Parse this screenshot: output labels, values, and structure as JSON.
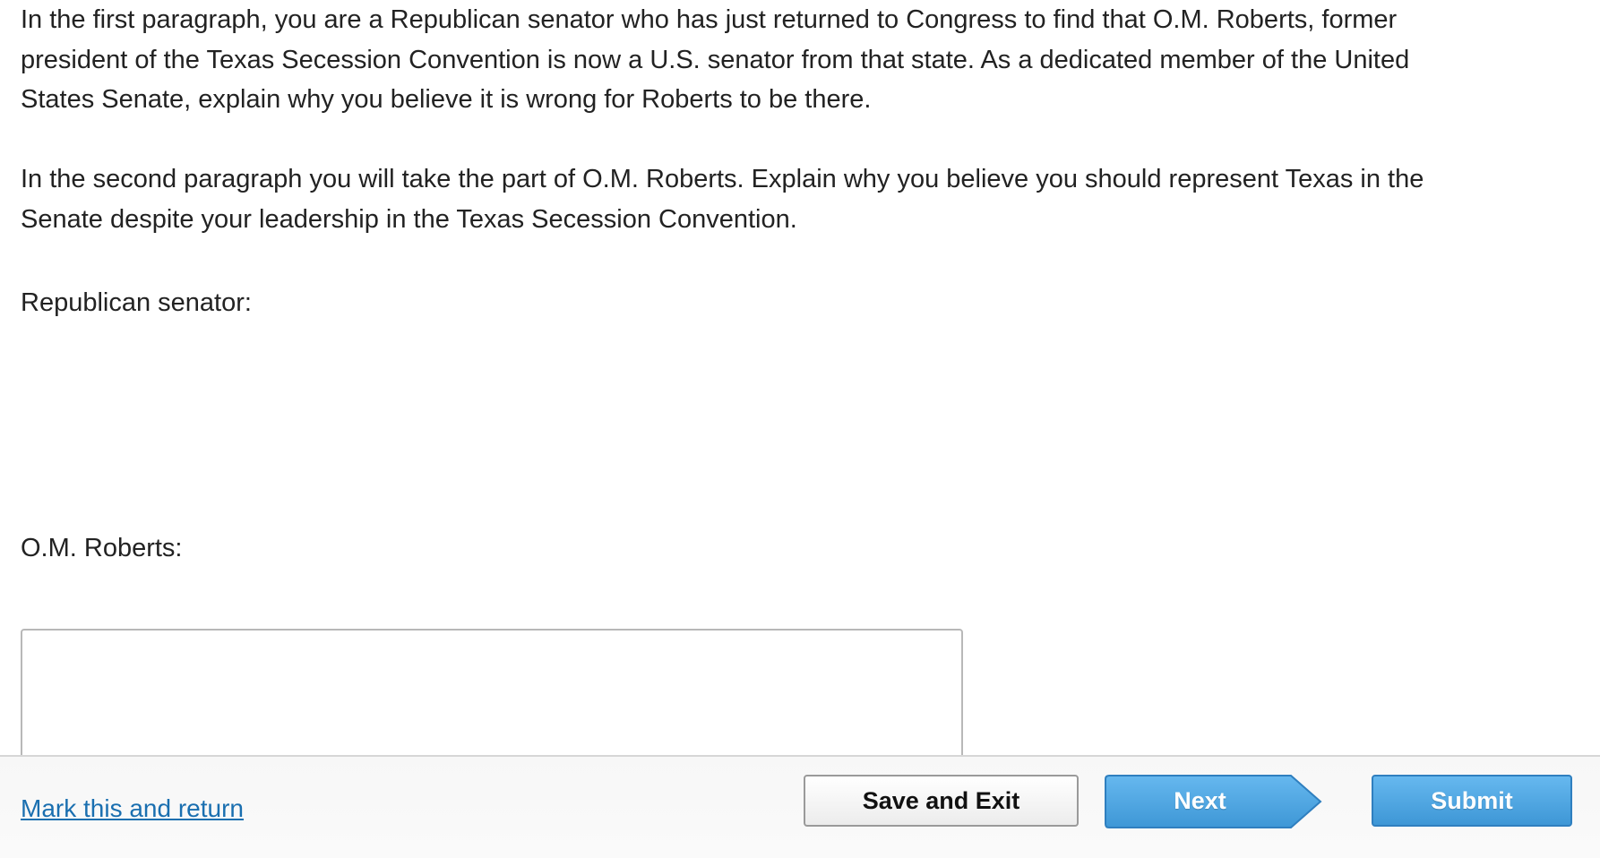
{
  "question": {
    "paragraph1_lines": [
      "In the first paragraph, you are a Republican senator who has just returned to Congress to find that O.M. Roberts, former",
      "president of the Texas Secession Convention is now a U.S. senator from that state.  As a dedicated member of the United",
      "States Senate, explain why you believe it is wrong for Roberts to be there."
    ],
    "paragraph2_lines": [
      "In the second paragraph you will take the part of O.M. Roberts.  Explain why you believe you should represent Texas in the",
      "Senate despite your leadership in the Texas Secession Convention."
    ],
    "label_senator": "Republican senator:",
    "label_roberts": "O.M. Roberts:"
  },
  "answer_box": {
    "value": ""
  },
  "footer": {
    "mark_link": "Mark this and return",
    "save_label": "Save and Exit",
    "next_label": "Next",
    "submit_label": "Submit"
  },
  "colors": {
    "link": "#1a6fb0",
    "primary_button": "#4aa3e0"
  }
}
